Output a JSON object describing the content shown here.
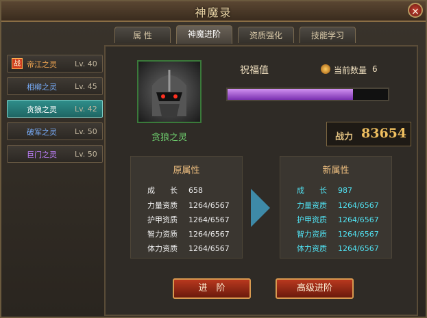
{
  "window": {
    "title": "神魔录",
    "close_label": "×"
  },
  "tabs": [
    {
      "label": "属 性",
      "active": false
    },
    {
      "label": "神魔进阶",
      "active": true
    },
    {
      "label": "资质强化",
      "active": false
    },
    {
      "label": "技能学习",
      "active": false
    }
  ],
  "sidebar": {
    "badge": "战",
    "items": [
      {
        "name": "帝江之灵",
        "level": "Lv. 40",
        "color": "#e8a050"
      },
      {
        "name": "相柳之灵",
        "level": "Lv. 45",
        "color": "#7ab0ff"
      },
      {
        "name": "贪狼之灵",
        "level": "Lv. 42",
        "color": "#ffffff"
      },
      {
        "name": "破军之灵",
        "level": "Lv. 50",
        "color": "#7ab0ff"
      },
      {
        "name": "巨门之灵",
        "level": "Lv. 50",
        "color": "#c080ff"
      }
    ]
  },
  "main": {
    "portrait_name": "贪狼之灵",
    "bless_label": "祝福值",
    "count_label": "当前数量",
    "count_value": "6",
    "bless_fill": 0.78,
    "power_label": "战力",
    "power_value": "83654",
    "old_attrs": {
      "title": "原属性",
      "rows": [
        {
          "k": "成　　长",
          "v": "658"
        },
        {
          "k": "力量资质",
          "v": "1264/6567"
        },
        {
          "k": "护甲资质",
          "v": "1264/6567"
        },
        {
          "k": "智力资质",
          "v": "1264/6567"
        },
        {
          "k": "体力资质",
          "v": "1264/6567"
        }
      ]
    },
    "new_attrs": {
      "title": "新属性",
      "rows": [
        {
          "k": "成　　长",
          "v": "987"
        },
        {
          "k": "力量资质",
          "v": "1264/6567"
        },
        {
          "k": "护甲资质",
          "v": "1264/6567"
        },
        {
          "k": "智力资质",
          "v": "1264/6567"
        },
        {
          "k": "体力资质",
          "v": "1264/6567"
        }
      ]
    },
    "btn_advance": "进　阶",
    "btn_high": "高级进阶"
  }
}
